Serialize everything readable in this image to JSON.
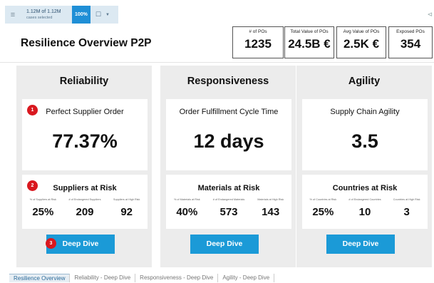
{
  "selection": {
    "count": "1.12M of 1.12M",
    "label": "cases selected",
    "percent": "100%",
    "menu_icon": "hamburger-icon",
    "chart_icon": "screen-icon",
    "dropdown_icon": "chevron-down-icon",
    "share_icon": "share-icon"
  },
  "page_title": "Resilience Overview P2P",
  "kpis": [
    {
      "label": "# of POs",
      "value": "1235"
    },
    {
      "label": "Total Value of POs",
      "value": "24.5B €"
    },
    {
      "label": "Avg Value of POs",
      "value": "2.5K €"
    },
    {
      "label": "Exposed POs",
      "value": "354"
    }
  ],
  "panels": [
    {
      "title": "Reliability",
      "main": {
        "title": "Perfect Supplier Order",
        "value": "77.37%",
        "badge": "1"
      },
      "risk": {
        "title": "Suppliers at Risk",
        "badge": "2",
        "metrics": [
          {
            "label": "% of Suppliers at Risk",
            "value": "25%"
          },
          {
            "label": "# of Endangered Suppliers",
            "value": "209"
          },
          {
            "label": "Suppliers at High Risk",
            "value": "92"
          }
        ]
      },
      "button": "Deep Dive",
      "button_badge": "3"
    },
    {
      "title": "Responsiveness",
      "main": {
        "title": "Order Fulfillment Cycle Time",
        "value": "12 days"
      },
      "risk": {
        "title": "Materials at Risk",
        "metrics": [
          {
            "label": "% of Materials at Risk",
            "value": "40%"
          },
          {
            "label": "# of Endangered Materials",
            "value": "573"
          },
          {
            "label": "Materials at High Risk",
            "value": "143"
          }
        ]
      },
      "button": "Deep Dive"
    },
    {
      "title": "Agility",
      "main": {
        "title": "Supply Chain Agility",
        "value": "3.5"
      },
      "risk": {
        "title": "Countries at Risk",
        "metrics": [
          {
            "label": "% of Countries at Risk",
            "value": "25%"
          },
          {
            "label": "# of Endangered Countries",
            "value": "10"
          },
          {
            "label": "Countries at High Risk",
            "value": "3"
          }
        ]
      },
      "button": "Deep Dive"
    }
  ],
  "tabs": [
    {
      "label": "Resilience Overview",
      "active": true
    },
    {
      "label": "Reliability - Deep Dive",
      "active": false
    },
    {
      "label": "Responsiveness - Deep Dive",
      "active": false
    },
    {
      "label": "Agility - Deep Dive",
      "active": false
    }
  ],
  "colors": {
    "accent": "#1b9ad7",
    "badge": "#d9181f",
    "panel": "#ececec"
  }
}
